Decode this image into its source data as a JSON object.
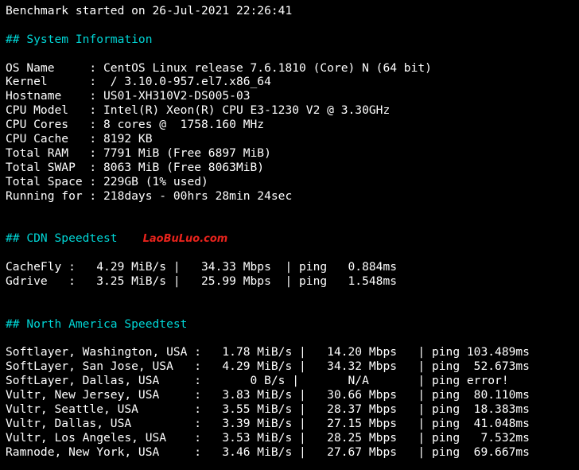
{
  "colors": {
    "background": "#000000",
    "text": "#ffffff",
    "heading": "#00d6d6",
    "watermark": "#e8231c"
  },
  "header": {
    "started_line": "Benchmark started on 26-Jul-2021 22:26:41"
  },
  "system_info": {
    "heading": "## System Information",
    "rows": [
      "OS Name     : CentOS Linux release 7.6.1810 (Core) N (64 bit)",
      "Kernel      :  / 3.10.0-957.el7.x86_64",
      "Hostname    : US01-XH310V2-DS005-03",
      "CPU Model   : Intel(R) Xeon(R) CPU E3-1230 V2 @ 3.30GHz",
      "CPU Cores   : 8 cores @  1758.160 MHz",
      "CPU Cache   : 8192 KB",
      "Total RAM   : 7791 MiB (Free 6897 MiB)",
      "Total SWAP  : 8063 MiB (Free 8063MiB)",
      "Total Space : 229GB (1% used)",
      "Running for : 218days - 00hrs 28min 24sec"
    ]
  },
  "cdn_speedtest": {
    "heading": "## CDN Speedtest",
    "watermark": "LaoBuLuo.com",
    "rows": [
      "CacheFly :   4.29 MiB/s |   34.33 Mbps  | ping   0.884ms",
      "Gdrive   :   3.25 MiB/s |   25.99 Mbps  | ping   1.548ms"
    ]
  },
  "north_america_speedtest": {
    "heading": "## North America Speedtest",
    "rows": [
      "Softlayer, Washington, USA :   1.78 MiB/s |   14.20 Mbps   | ping 103.489ms",
      "SoftLayer, San Jose, USA   :   4.29 MiB/s |   34.32 Mbps   | ping  52.673ms",
      "SoftLayer, Dallas, USA     :       0 B/s |       N/A       | ping error!",
      "Vultr, New Jersey, USA     :   3.83 MiB/s |   30.66 Mbps   | ping  80.110ms",
      "Vultr, Seattle, USA        :   3.55 MiB/s |   28.37 Mbps   | ping  18.383ms",
      "Vultr, Dallas, USA         :   3.39 MiB/s |   27.15 Mbps   | ping  41.048ms",
      "Vultr, Los Angeles, USA    :   3.53 MiB/s |   28.25 Mbps   | ping   7.532ms",
      "Ramnode, New York, USA     :   3.46 MiB/s |   27.67 Mbps   | ping  69.667ms"
    ]
  }
}
